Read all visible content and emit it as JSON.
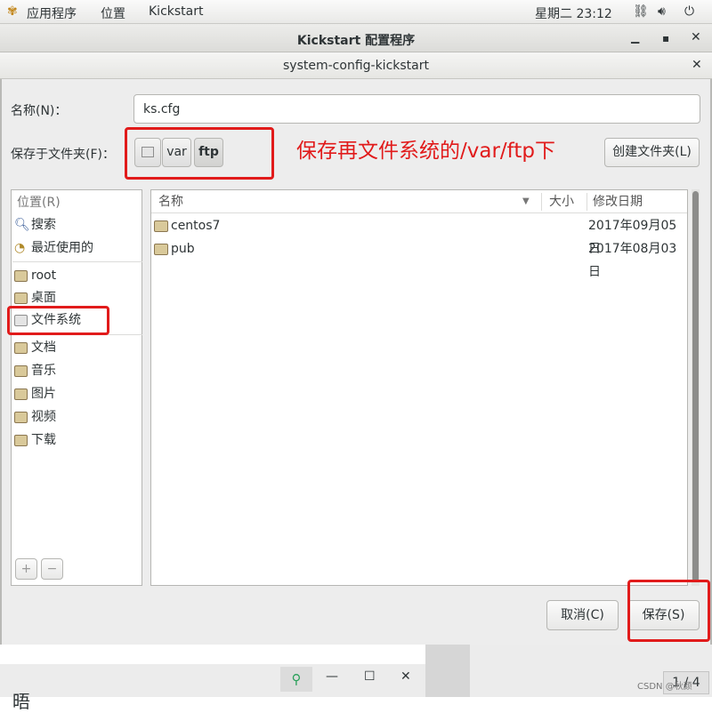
{
  "topbar": {
    "apps": "应用程序",
    "places": "位置",
    "app": "Kickstart",
    "clock": "星期二 23:12"
  },
  "parent_window": {
    "title": "Kickstart 配置程序"
  },
  "dialog": {
    "title": "system-config-kickstart",
    "name_label": "名称(N)：",
    "name_value": "ks.cfg",
    "save_in_label": "保存于文件夹(F)：",
    "path": [
      "var",
      "ftp"
    ],
    "annotation": "保存再文件系统的/var/ftp下",
    "create_folder": "创建文件夹(L)",
    "places_header": "位置(R)",
    "places_group1": [
      {
        "label": "搜索",
        "icon": "search-icon"
      },
      {
        "label": "最近使用的",
        "icon": "recent-icon"
      }
    ],
    "places_group2": [
      {
        "label": "root",
        "icon": "home-folder-icon"
      },
      {
        "label": "桌面",
        "icon": "desktop-folder-icon"
      },
      {
        "label": "文件系统",
        "icon": "drive-icon"
      }
    ],
    "places_group3": [
      {
        "label": "文档",
        "icon": "documents-folder-icon"
      },
      {
        "label": "音乐",
        "icon": "music-folder-icon"
      },
      {
        "label": "图片",
        "icon": "pictures-folder-icon"
      },
      {
        "label": "视频",
        "icon": "videos-folder-icon"
      },
      {
        "label": "下载",
        "icon": "downloads-folder-icon"
      }
    ],
    "add_symbol": "+",
    "remove_symbol": "−",
    "columns": {
      "name": "名称",
      "size": "大小",
      "modified": "修改日期"
    },
    "files": [
      {
        "name": "centos7",
        "date": "2017年09月05日"
      },
      {
        "name": "pub",
        "date": "2017年08月03日"
      }
    ],
    "cancel": "取消(C)",
    "save": "保存(S)"
  },
  "taskbar": {
    "pager": "1 / 4",
    "credit": "CSDN @秋颜",
    "partial_char": "晤"
  },
  "colors": {
    "red_annotation": "#e11b1b",
    "panel_border": "#b6b6b3"
  }
}
